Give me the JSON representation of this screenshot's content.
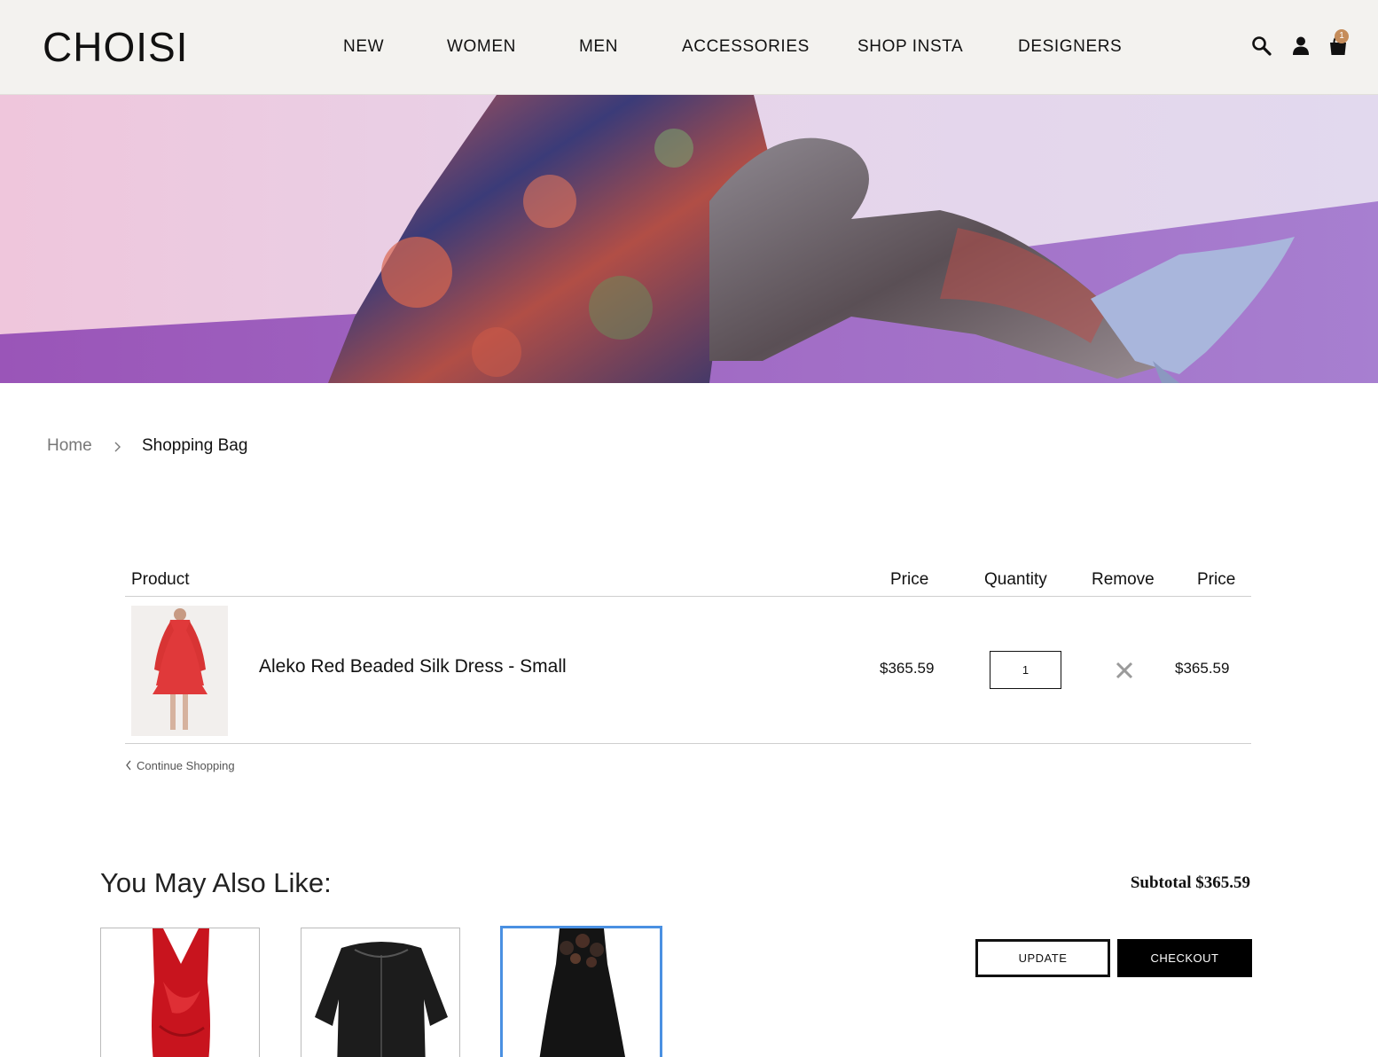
{
  "header": {
    "logo": "CHOISI",
    "nav": [
      "NEW",
      "WOMEN",
      "MEN",
      "ACCESSORIES",
      "SHOP INSTA",
      "DESIGNERS"
    ],
    "cart_count": "1",
    "icons": [
      "search-icon",
      "account-icon",
      "shopping-bag-icon"
    ]
  },
  "breadcrumb": {
    "home": "Home",
    "current": "Shopping Bag"
  },
  "cart": {
    "columns": {
      "product": "Product",
      "price": "Price",
      "quantity": "Quantity",
      "remove": "Remove",
      "total": "Price"
    },
    "items": [
      {
        "name": "Aleko Red Beaded Silk Dress - Small",
        "price": "$365.59",
        "quantity": "1",
        "total": "$365.59"
      }
    ],
    "continue_label": "Continue Shopping"
  },
  "recommendations": {
    "title": "You May Also Like:",
    "items": [
      "red satin dress",
      "black tweed jacket",
      "black embellished dress"
    ]
  },
  "summary": {
    "subtotal": "Subtotal $365.59",
    "update_label": "UPDATE",
    "checkout_label": "CHECKOUT"
  },
  "colors": {
    "header_bg": "#f3f2ef",
    "badge": "#c58c5a",
    "selected_border": "#4a90e2",
    "checkout_bg": "#000000"
  }
}
